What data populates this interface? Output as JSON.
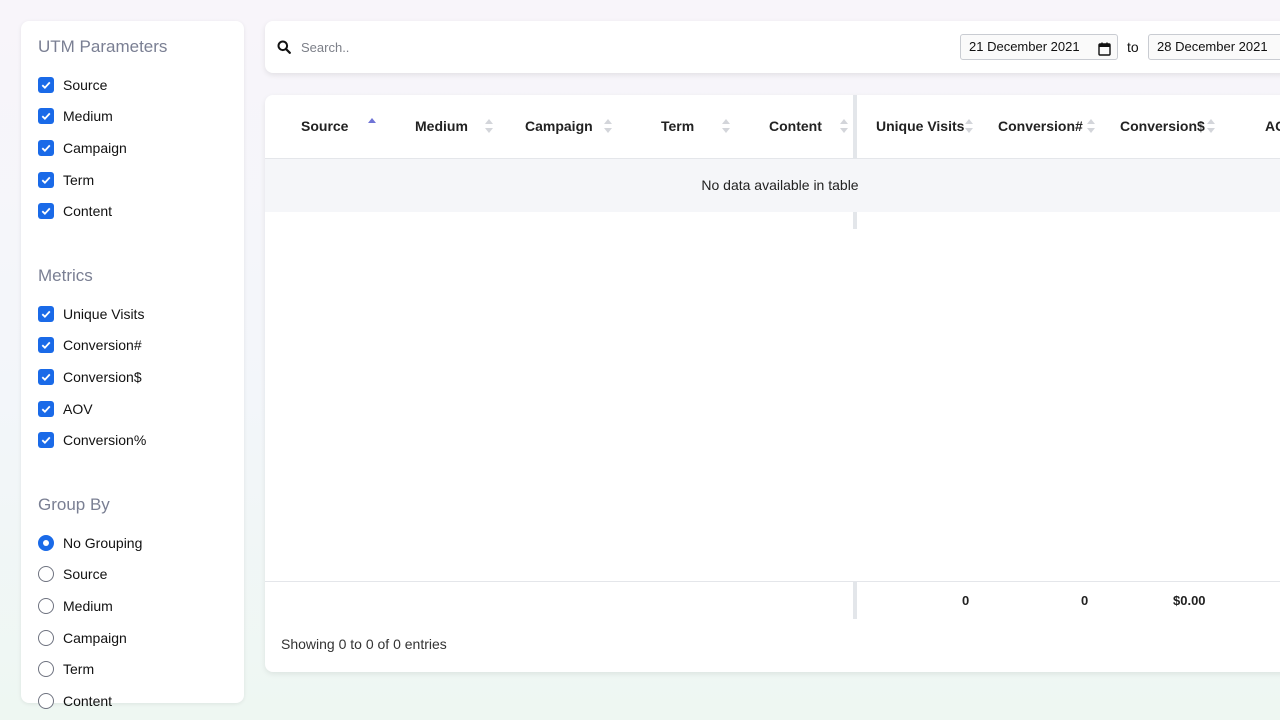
{
  "sidebar": {
    "utm": {
      "title": "UTM Parameters",
      "items": [
        {
          "label": "Source",
          "checked": true
        },
        {
          "label": "Medium",
          "checked": true
        },
        {
          "label": "Campaign",
          "checked": true
        },
        {
          "label": "Term",
          "checked": true
        },
        {
          "label": "Content",
          "checked": true
        }
      ]
    },
    "metrics": {
      "title": "Metrics",
      "items": [
        {
          "label": "Unique Visits",
          "checked": true
        },
        {
          "label": "Conversion#",
          "checked": true
        },
        {
          "label": "Conversion$",
          "checked": true
        },
        {
          "label": "AOV",
          "checked": true
        },
        {
          "label": "Conversion%",
          "checked": true
        }
      ]
    },
    "group_by": {
      "title": "Group By",
      "selected": "No Grouping",
      "items": [
        {
          "label": "No Grouping"
        },
        {
          "label": "Source"
        },
        {
          "label": "Medium"
        },
        {
          "label": "Campaign"
        },
        {
          "label": "Term"
        },
        {
          "label": "Content"
        }
      ]
    }
  },
  "search": {
    "placeholder": "Search..",
    "value": ""
  },
  "date_range": {
    "from": "21 December 2021",
    "separator": "to",
    "to": "28 December 2021"
  },
  "table": {
    "columns": [
      {
        "label": "Source",
        "sort": "asc"
      },
      {
        "label": "Medium",
        "sort": "none"
      },
      {
        "label": "Campaign",
        "sort": "none"
      },
      {
        "label": "Term",
        "sort": "none"
      },
      {
        "label": "Content",
        "sort": "none"
      },
      {
        "label": "Unique Visits",
        "sort": "none"
      },
      {
        "label": "Conversion#",
        "sort": "none"
      },
      {
        "label": "Conversion$",
        "sort": "none"
      },
      {
        "label": "AC",
        "sort": "none"
      }
    ],
    "empty_message": "No data available in table",
    "footer": {
      "unique_visits": "0",
      "conversion_count": "0",
      "conversion_value": "$0.00"
    },
    "info": "Showing 0 to 0 of 0 entries"
  },
  "colors": {
    "accent": "#1a6ae8",
    "sort_active": "#6f74d6",
    "sort_inactive": "#d3d5da"
  }
}
